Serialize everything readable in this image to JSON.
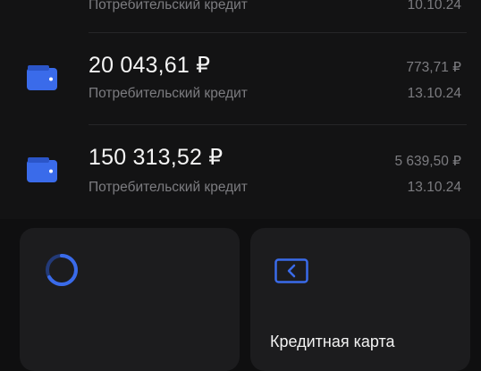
{
  "colors": {
    "background": "#0f0f10",
    "accent_blue": "#3a6bea",
    "text_primary": "#f4f4f4",
    "text_secondary": "#7c7c80",
    "card_bg": "#1c1c1e"
  },
  "loans": [
    {
      "amount": "",
      "subtitle": "Потребительский кредит",
      "payment": "",
      "date": "10.10.24",
      "icon": "wallet-icon"
    },
    {
      "amount": "20 043,61 ₽",
      "subtitle": "Потребительский кредит",
      "payment": "773,71 ₽",
      "date": "13.10.24",
      "icon": "wallet-icon"
    },
    {
      "amount": "150 313,52 ₽",
      "subtitle": "Потребительский кредит",
      "payment": "5 639,50 ₽",
      "date": "13.10.24",
      "icon": "wallet-icon"
    }
  ],
  "tiles": [
    {
      "icon": "progress-ring-icon",
      "label": ""
    },
    {
      "icon": "credit-card-icon",
      "label": "Кредитная карта"
    }
  ]
}
